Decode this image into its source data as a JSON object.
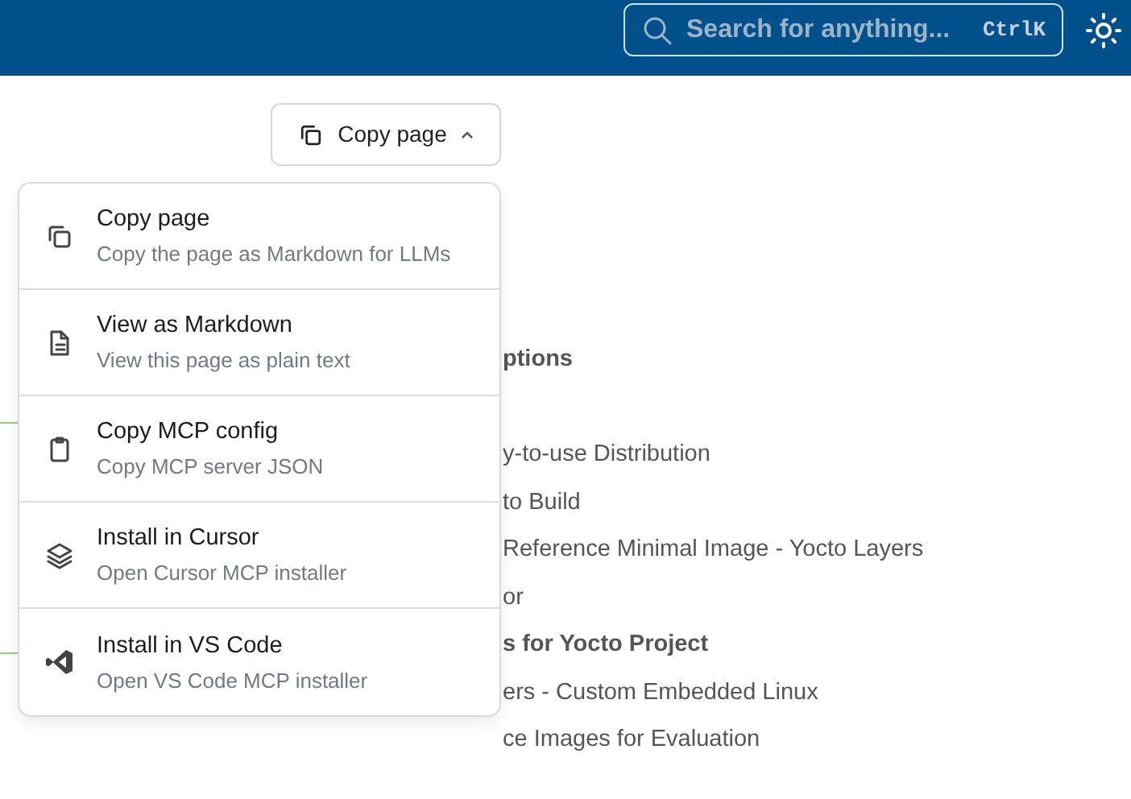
{
  "header": {
    "search": {
      "placeholder": "Search for anything...",
      "shortcut": "CtrlK"
    }
  },
  "copy_button": {
    "label": "Copy page",
    "expanded": true
  },
  "menu": [
    {
      "title": "Copy page",
      "subtitle": "Copy the page as Markdown for LLMs"
    },
    {
      "title": "View as Markdown",
      "subtitle": "View this page as plain text"
    },
    {
      "title": "Copy MCP config",
      "subtitle": "Copy MCP server JSON"
    },
    {
      "title": "Install in Cursor",
      "subtitle": "Open Cursor MCP installer"
    },
    {
      "title": "Install in VS Code",
      "subtitle": "Open VS Code MCP installer"
    }
  ],
  "toc": [
    {
      "text": "ptions",
      "kind": "heading"
    },
    {
      "kind": "gap"
    },
    {
      "text": "y-to-use Distribution",
      "kind": "link"
    },
    {
      "text": "to Build",
      "kind": "link"
    },
    {
      "text": "Reference Minimal Image - Yocto Layers",
      "kind": "link"
    },
    {
      "text": "or",
      "kind": "link"
    },
    {
      "text": "s for Yocto Project",
      "kind": "heading"
    },
    {
      "text": "ers - Custom Embedded Linux",
      "kind": "link"
    },
    {
      "text": "ce Images for Evaluation",
      "kind": "link"
    }
  ]
}
